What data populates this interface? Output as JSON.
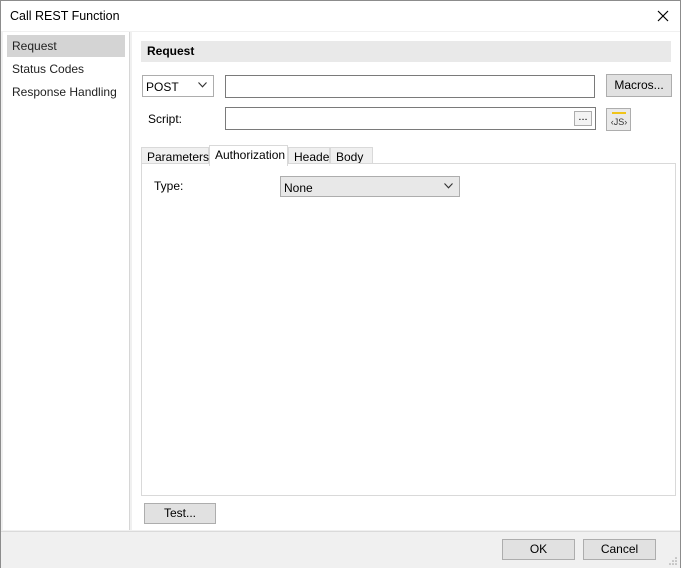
{
  "window": {
    "title": "Call REST Function"
  },
  "nav": {
    "items": [
      {
        "label": "Request",
        "selected": true
      },
      {
        "label": "Status Codes",
        "selected": false
      },
      {
        "label": "Response Handling",
        "selected": false
      }
    ]
  },
  "request": {
    "header": "Request",
    "method": "POST",
    "url_value": "",
    "macros_label": "Macros...",
    "script_label": "Script:",
    "script_value": "",
    "browse_label": "...",
    "js_icon": "js-script-icon",
    "tabs": [
      {
        "label": "Parameters",
        "active": false
      },
      {
        "label": "Authorization",
        "active": true
      },
      {
        "label": "Header",
        "active": false
      },
      {
        "label": "Body",
        "active": false
      }
    ],
    "auth": {
      "type_label": "Type:",
      "type_value": "None"
    },
    "test_label": "Test..."
  },
  "footer": {
    "ok_label": "OK",
    "cancel_label": "Cancel"
  },
  "colors": {
    "selected_nav": "#d4d4d4",
    "panel_bg": "#f0f0f0",
    "js_icon_accent": "#f0c419"
  }
}
